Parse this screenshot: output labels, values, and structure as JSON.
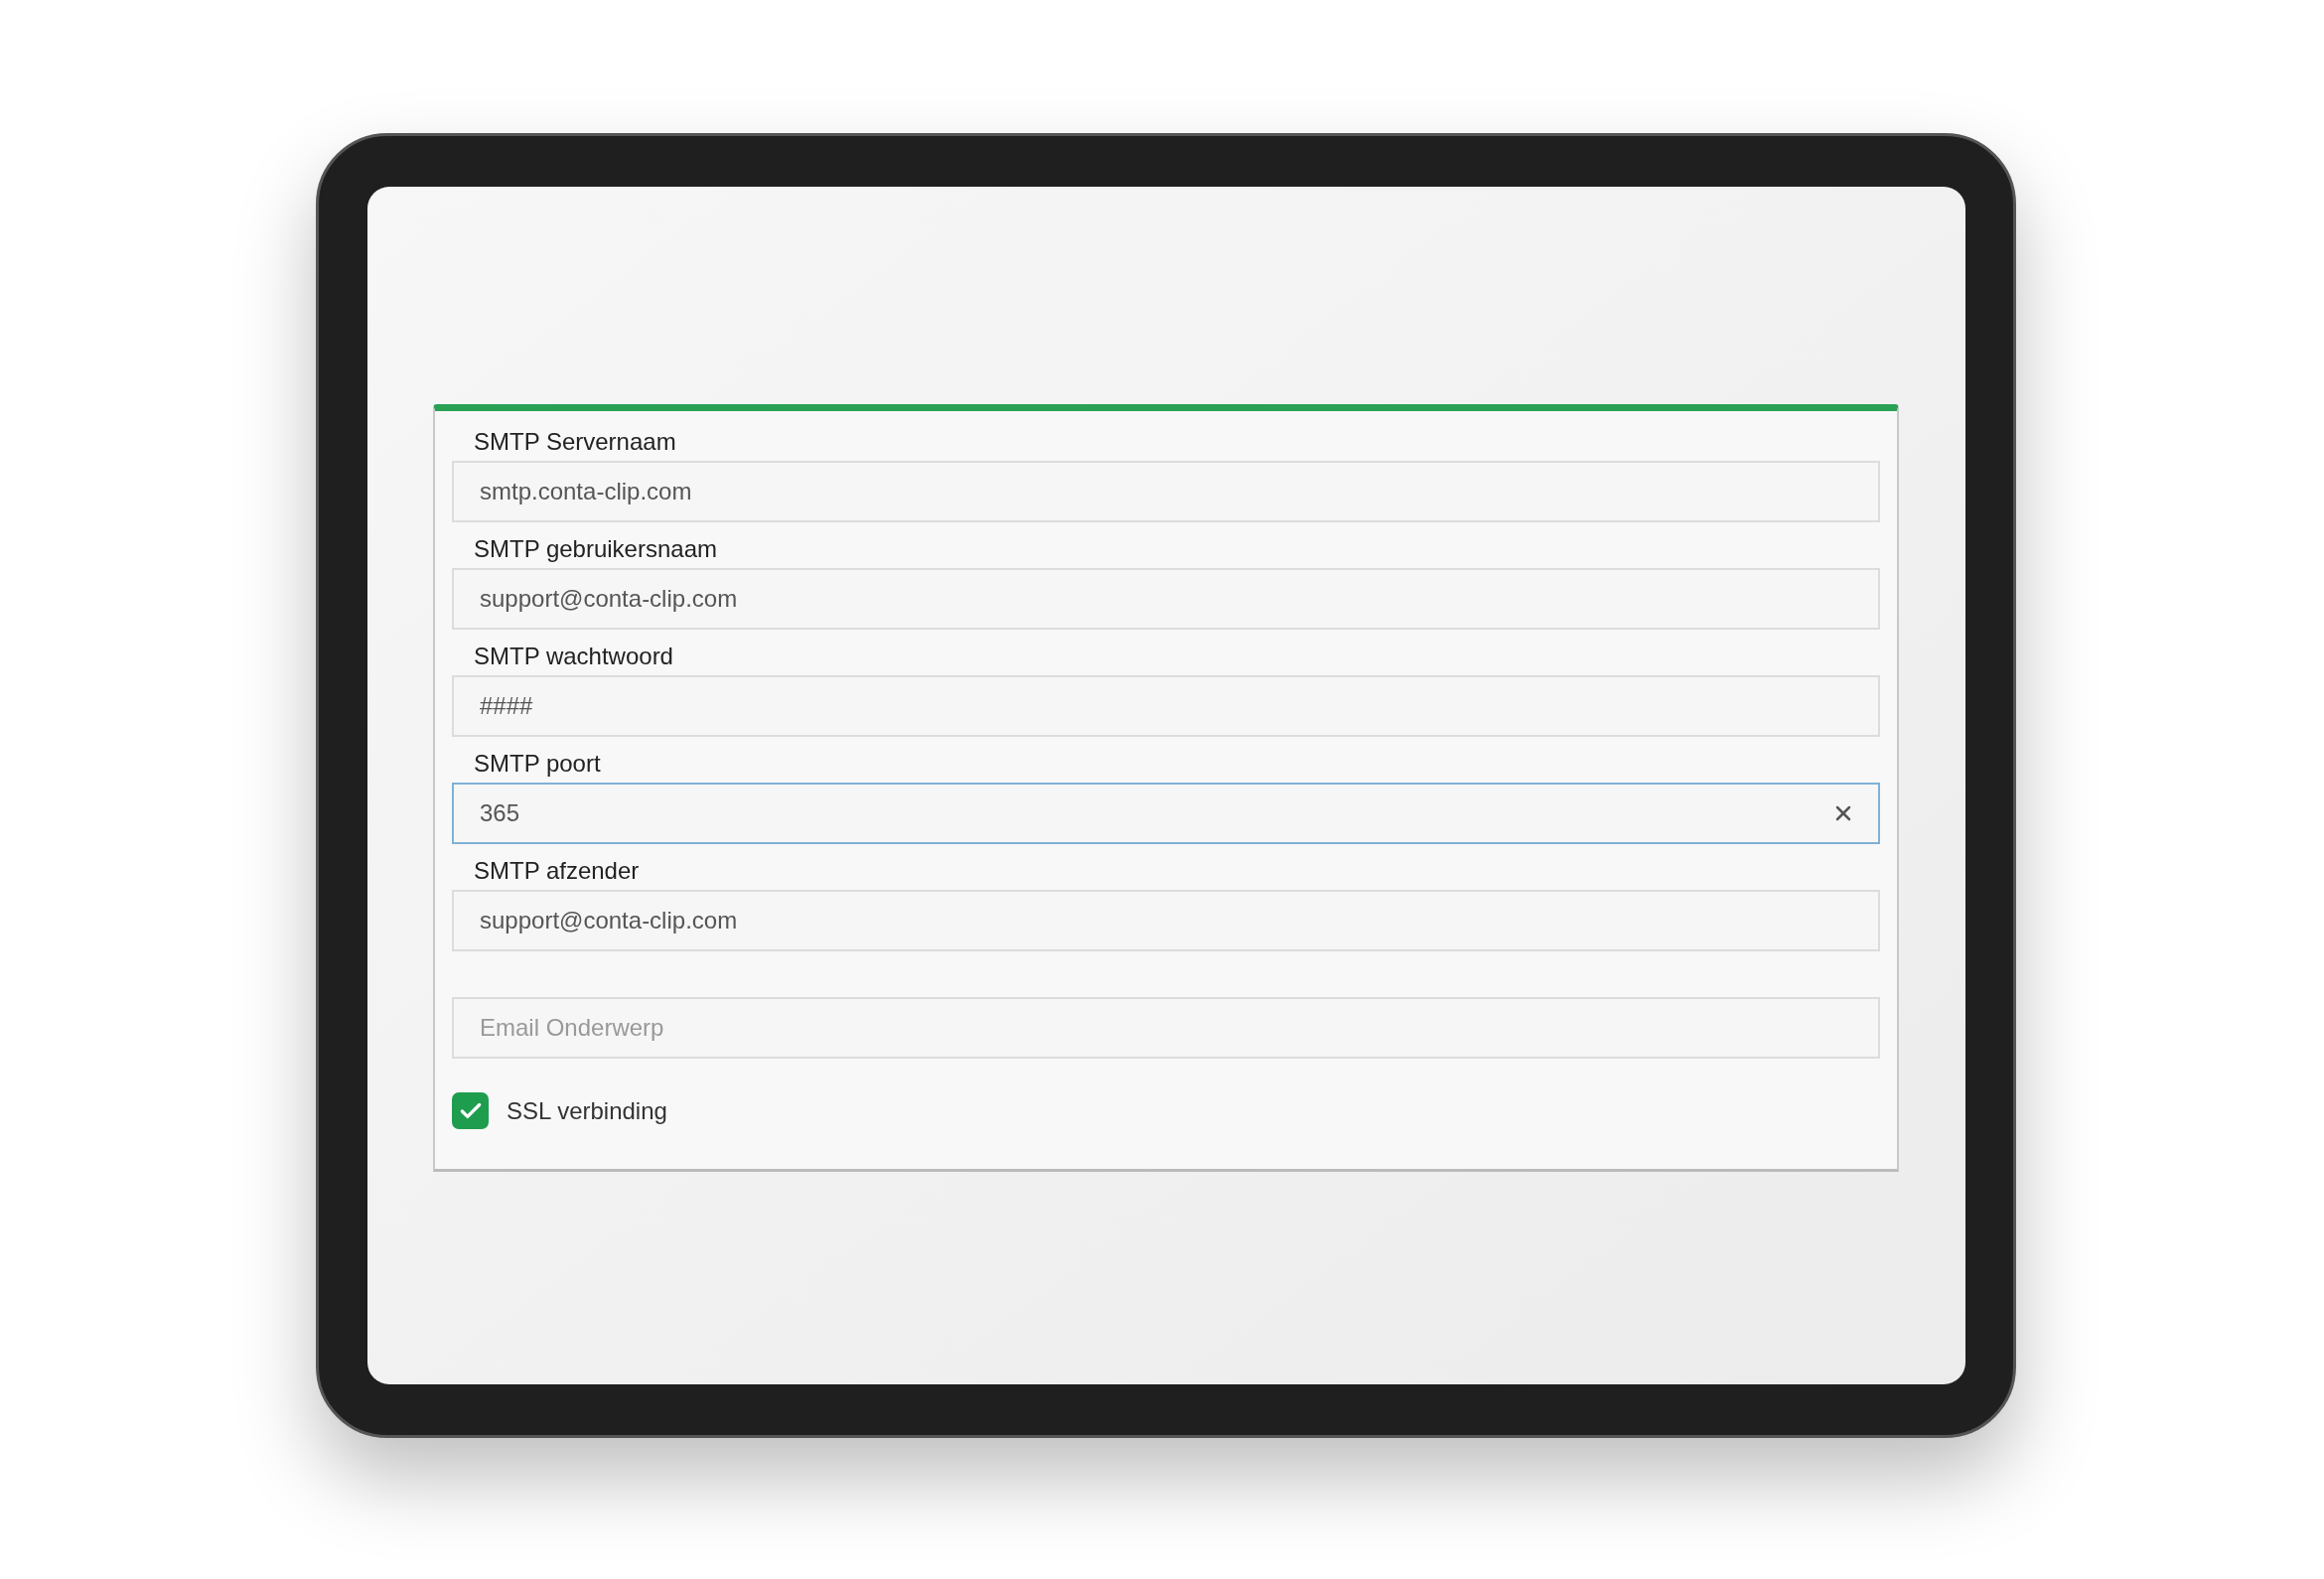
{
  "fields": [
    {
      "label": "SMTP Servernaam",
      "value": "smtp.conta-clip.com",
      "focused": false
    },
    {
      "label": "SMTP gebruikersnaam",
      "value": "support@conta-clip.com",
      "focused": false
    },
    {
      "label": "SMTP wachtwoord",
      "value": "####",
      "focused": false
    },
    {
      "label": "SMTP poort",
      "value": "365",
      "focused": true
    },
    {
      "label": "SMTP afzender",
      "value": "support@conta-clip.com",
      "focused": false
    },
    {
      "placeholder": "Email Onderwerp",
      "focused": false
    }
  ],
  "ssl": {
    "label": "SSL verbinding",
    "checked": true
  }
}
